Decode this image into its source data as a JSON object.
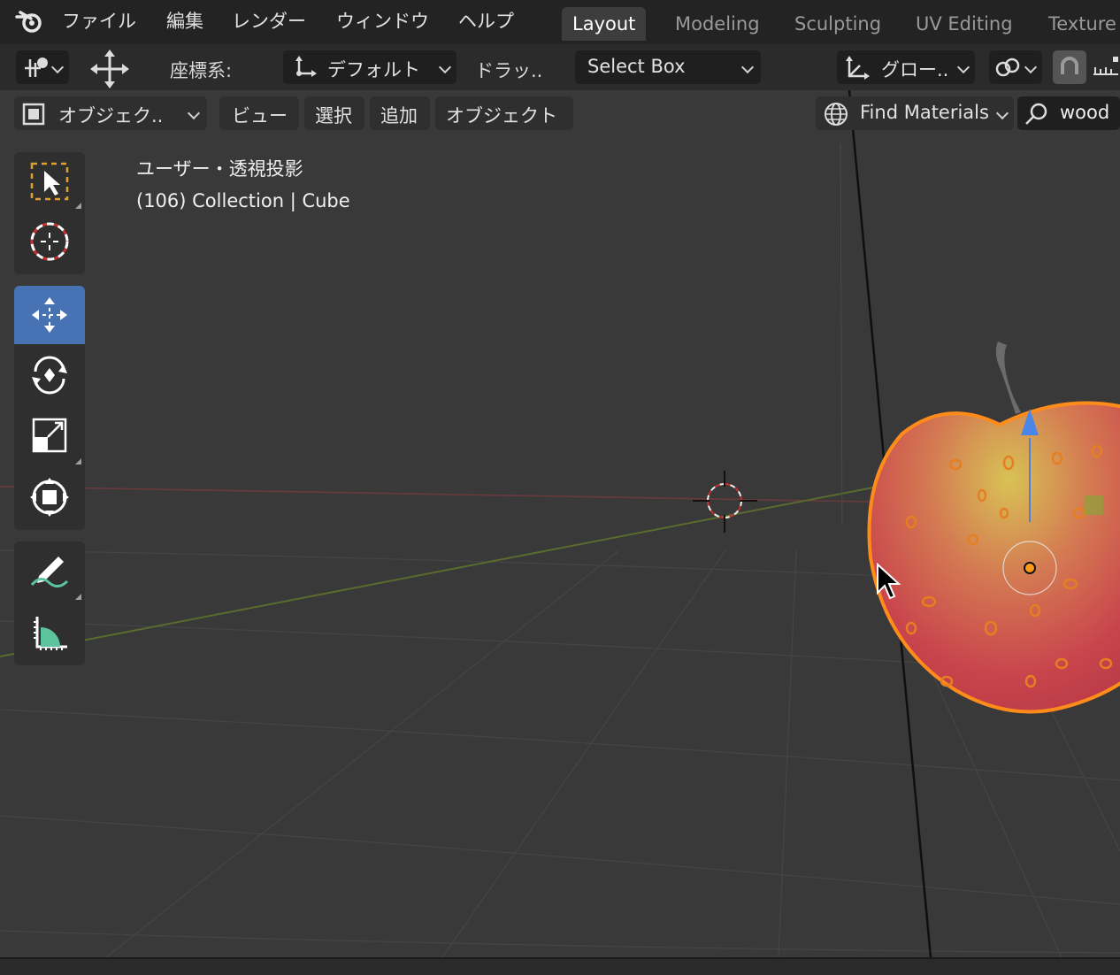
{
  "menu": {
    "file": "ファイル",
    "edit": "編集",
    "render": "レンダー",
    "window": "ウィンドウ",
    "help": "ヘルプ"
  },
  "workspace_tabs": [
    "Layout",
    "Modeling",
    "Sculpting",
    "UV Editing",
    "Texture"
  ],
  "active_tab": "Layout",
  "tool_settings": {
    "orientation_label": "座標系:",
    "orientation_value": "デフォルト",
    "drag_label": "ドラッ..",
    "drag_value": "Select Box",
    "transform_orientation": "グロー.."
  },
  "header": {
    "mode": "オブジェク..",
    "view": "ビュー",
    "select": "選択",
    "add": "追加",
    "object": "オブジェクト",
    "asset_library": "Find Materials",
    "search_value": "wood"
  },
  "viewport": {
    "view_name": "ユーザー・透視投影",
    "collection_info": "(106) Collection | Cube"
  },
  "toolbox": {
    "active_tool": "move",
    "tools": [
      "select-box",
      "cursor",
      "move",
      "rotate",
      "scale",
      "transform",
      "annotate",
      "measure"
    ]
  },
  "colors": {
    "accent": "#4772b3",
    "selection_outline": "#ff8c1a",
    "background": "#393939"
  }
}
